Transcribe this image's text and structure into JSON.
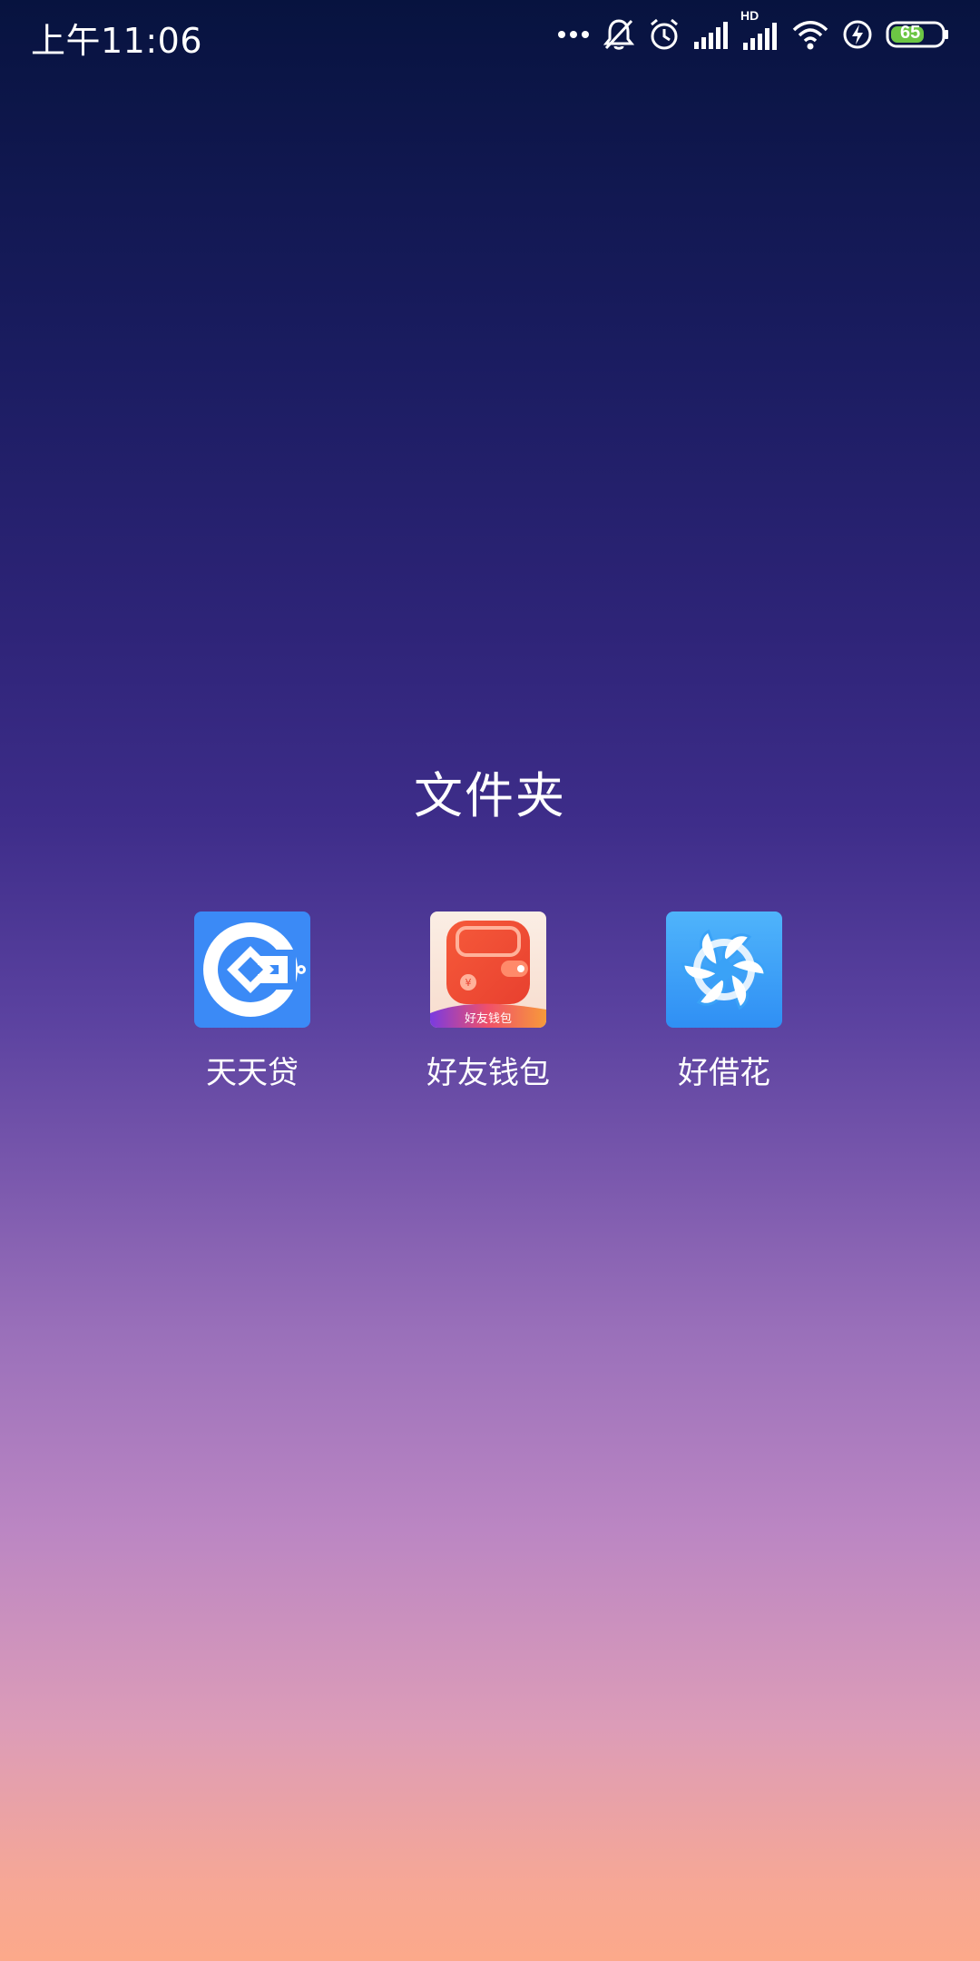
{
  "status_bar": {
    "time": "上午11:06",
    "battery_level": "65",
    "icons": [
      "more-dots-icon",
      "mute-bell-icon",
      "alarm-icon",
      "signal-icon",
      "hd-signal-icon",
      "wifi-icon",
      "charging-bolt-icon",
      "battery-icon"
    ],
    "hd_label": "HD"
  },
  "folder": {
    "title": "文件夹",
    "apps": [
      {
        "label": "天天贷",
        "icon": "tiantiandai-icon",
        "color": "#3b8af6"
      },
      {
        "label": "好友钱包",
        "icon": "haoyou-wallet-icon",
        "color": "#f2593f",
        "icon_caption": "好友钱包"
      },
      {
        "label": "好借花",
        "icon": "haojiehua-icon",
        "color": "#3aa2f7"
      }
    ]
  },
  "colors": {
    "gradient_top": "#07133f",
    "gradient_bottom": "#fca98a",
    "battery_fill": "#6cc644"
  }
}
